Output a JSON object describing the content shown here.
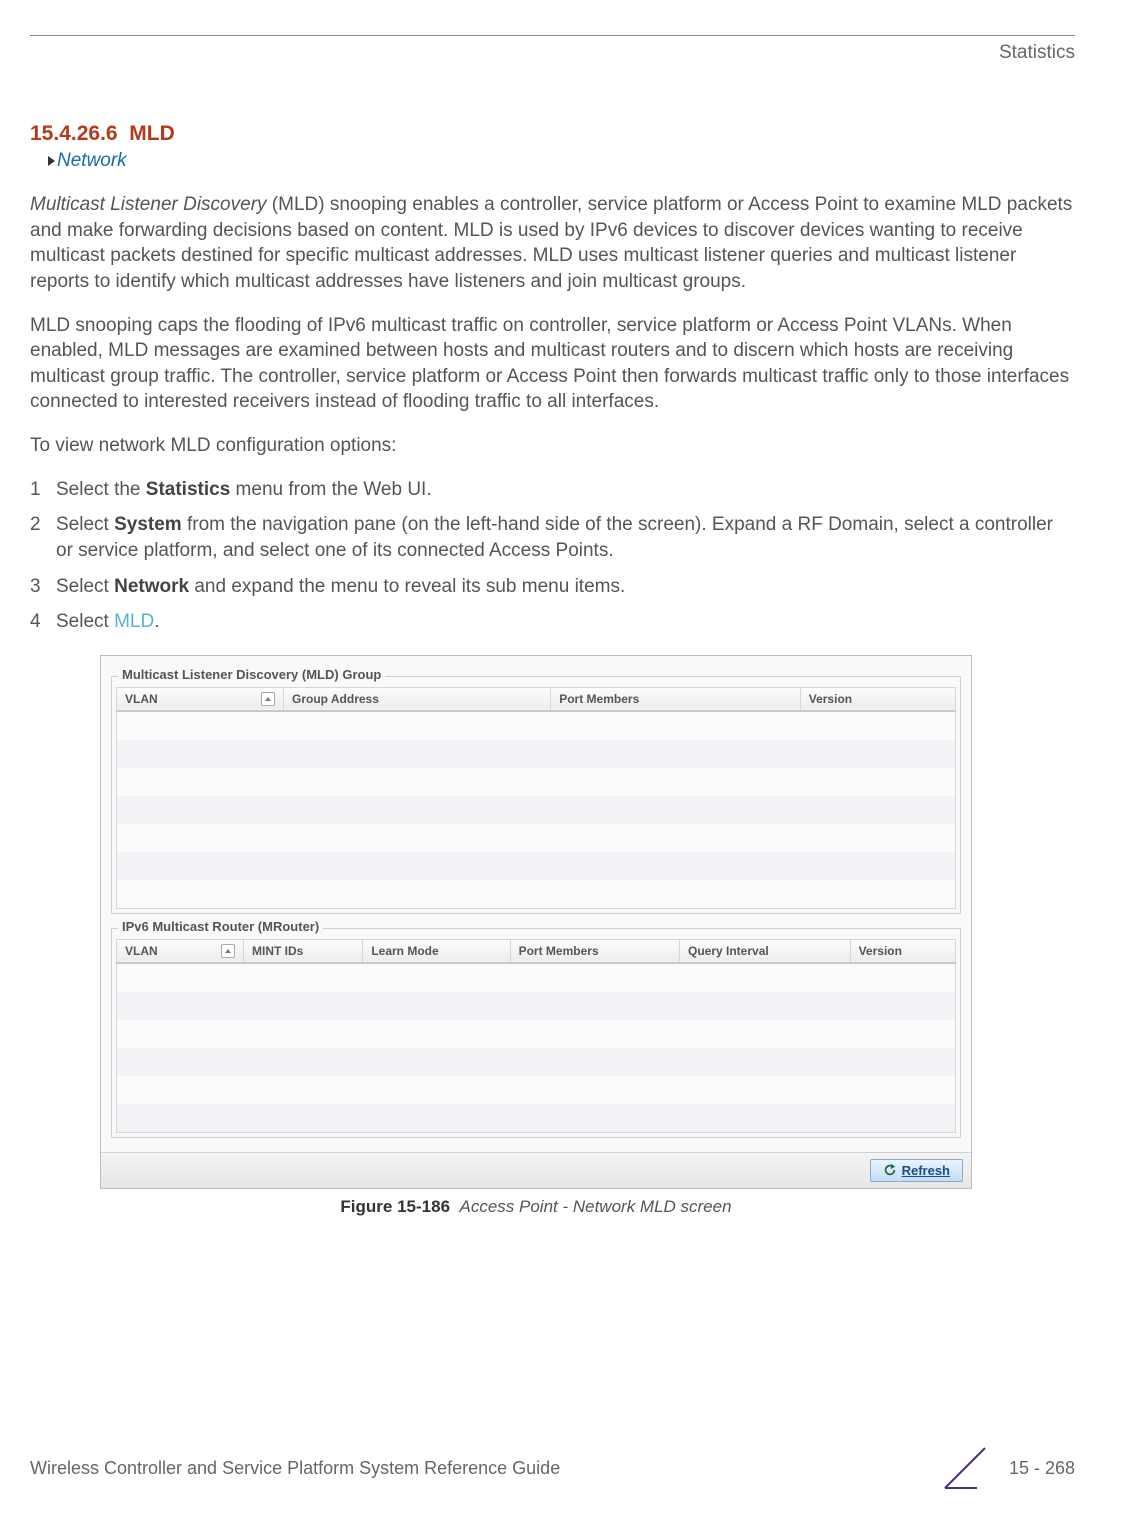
{
  "header": {
    "chapter": "Statistics"
  },
  "section": {
    "number": "15.4.26.6",
    "title": "MLD",
    "breadcrumb": "Network"
  },
  "paragraphs": {
    "p1_lead_italic": "Multicast Listener Discovery",
    "p1_rest": " (MLD) snooping enables a controller, service platform or Access Point to examine MLD packets and make forwarding decisions based on content. MLD is used by IPv6 devices to discover devices wanting to receive multicast packets destined for specific multicast addresses. MLD uses multicast listener queries and multicast listener reports to identify which multicast addresses have listeners and join multicast groups.",
    "p2": "MLD snooping caps the flooding of IPv6 multicast traffic on controller, service platform or Access Point VLANs. When enabled, MLD messages are examined between hosts and multicast routers and to discern which hosts are receiving multicast group traffic. The controller, service platform or Access Point then forwards multicast traffic only to those interfaces connected to interested receivers instead of flooding traffic to all interfaces.",
    "p3": "To view network MLD configuration options:"
  },
  "steps": [
    {
      "n": "1",
      "pre": "Select the ",
      "bold": "Statistics",
      "post": " menu from the Web UI."
    },
    {
      "n": "2",
      "pre": "Select ",
      "bold": "System",
      "post": " from the navigation pane (on the left-hand side of the screen). Expand a RF Domain, select a controller or service platform, and select one of its connected Access Points."
    },
    {
      "n": "3",
      "pre": "Select ",
      "bold": "Network",
      "post": " and expand the menu to reveal its sub menu items."
    },
    {
      "n": "4",
      "pre": "Select ",
      "link": "MLD",
      "post": "."
    }
  ],
  "figure": {
    "group1": {
      "legend": "Multicast Listener Discovery (MLD) Group",
      "columns": [
        "VLAN",
        "Group Address",
        "Port Members",
        "Version"
      ]
    },
    "group2": {
      "legend": "IPv6 Multicast Router (MRouter)",
      "columns": [
        "VLAN",
        "MINT IDs",
        "Learn Mode",
        "Port Members",
        "Query Interval",
        "Version"
      ]
    },
    "refresh": "Refresh",
    "caption_label": "Figure 15-186",
    "caption_text": "Access Point - Network MLD screen"
  },
  "footer": {
    "left": "Wireless Controller and Service Platform System Reference Guide",
    "right": "15 - 268"
  }
}
